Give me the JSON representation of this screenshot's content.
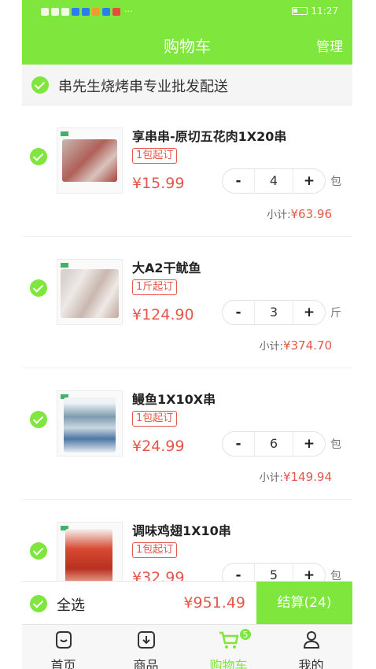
{
  "status_bar": {
    "time": "11:27",
    "left_indicators": "···"
  },
  "header": {
    "title": "购物车",
    "manage": "管理"
  },
  "shop": {
    "name": "串先生烧烤串专业批发配送",
    "selected": true
  },
  "items": [
    {
      "name": "享串串-原切五花肉1X20串",
      "min_order": "1包起订",
      "price": "¥15.99",
      "quantity": "4",
      "unit": "包",
      "subtotal_label": "小计:",
      "subtotal": "¥63.96",
      "selected": true
    },
    {
      "name": "大A2干鱿鱼",
      "min_order": "1斤起订",
      "price": "¥124.90",
      "quantity": "3",
      "unit": "斤",
      "subtotal_label": "小计:",
      "subtotal": "¥374.70",
      "selected": true
    },
    {
      "name": "鳗鱼1X10X串",
      "min_order": "1包起订",
      "price": "¥24.99",
      "quantity": "6",
      "unit": "包",
      "subtotal_label": "小计:",
      "subtotal": "¥149.94",
      "selected": true
    },
    {
      "name": "调味鸡翅1X10串",
      "min_order": "1包起订",
      "price": "¥32.99",
      "quantity": "5",
      "unit": "包",
      "selected": true
    }
  ],
  "stepper": {
    "minus": "-",
    "plus": "+"
  },
  "checkout": {
    "select_all": "全选",
    "total": "¥951.49",
    "settle": "结算(24)"
  },
  "tabs": [
    {
      "label": "首页",
      "icon": "home-icon"
    },
    {
      "label": "商品",
      "icon": "products-icon"
    },
    {
      "label": "购物车",
      "icon": "cart-icon",
      "badge": "5",
      "active": true
    },
    {
      "label": "我的",
      "icon": "profile-icon"
    }
  ],
  "colors": {
    "accent": "#7ee63c",
    "price": "#e4574a"
  }
}
